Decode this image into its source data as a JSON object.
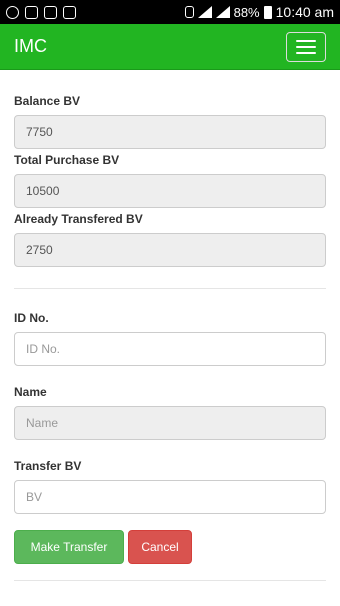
{
  "status_bar": {
    "battery": "88%",
    "time": "10:40 am"
  },
  "navbar": {
    "brand": "IMC"
  },
  "form": {
    "balance_bv": {
      "label": "Balance BV",
      "value": "7750"
    },
    "total_purchase_bv": {
      "label": "Total Purchase BV",
      "value": "10500"
    },
    "already_transfered_bv": {
      "label": "Already Transfered BV",
      "value": "2750"
    },
    "id_no": {
      "label": "ID No.",
      "placeholder": "ID No."
    },
    "name": {
      "label": "Name",
      "placeholder": "Name"
    },
    "transfer_bv": {
      "label": "Transfer BV",
      "placeholder": "BV"
    }
  },
  "buttons": {
    "make_transfer": "Make Transfer",
    "cancel": "Cancel"
  }
}
